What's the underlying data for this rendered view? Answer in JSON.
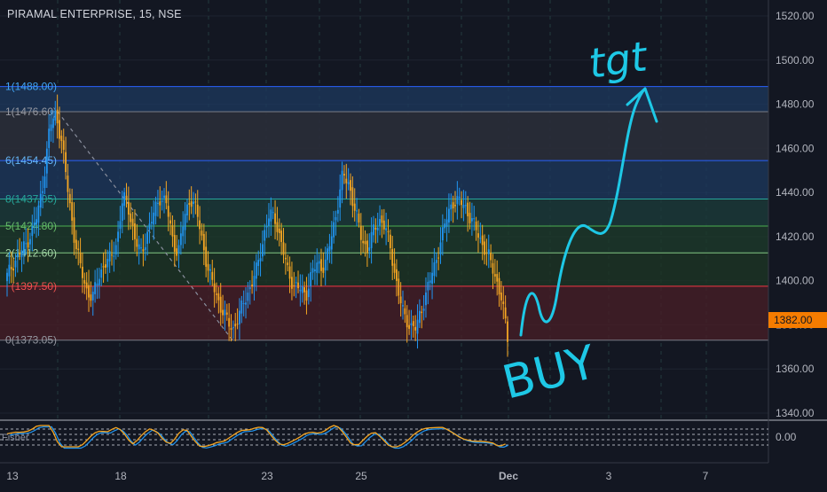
{
  "header": {
    "title": "PIRAMAL ENTERPRISE, 15, NSE"
  },
  "colors": {
    "background": "#131722",
    "grid": "#1e2330",
    "vgrid": "#233b3d",
    "candle_up": "#2196f3",
    "candle_down": "#f5a623",
    "axis_text": "#b2b5be",
    "annotation": "#1ec8e6",
    "price_badge": "#f57c00"
  },
  "price_axis": {
    "ticks": [
      "1520.00",
      "1500.00",
      "1480.00",
      "1460.00",
      "1440.00",
      "1420.00",
      "1400.00",
      "1380.00",
      "1360.00",
      "1340.00"
    ],
    "current_price": "1382.00"
  },
  "time_axis": {
    "ticks": [
      "13",
      "18",
      "23",
      "25",
      "Dec",
      "3",
      "7"
    ]
  },
  "oscillator": {
    "label": "Fisher",
    "tick": "0.00"
  },
  "annotations": {
    "target": "tgt",
    "action": "BUY"
  },
  "chart_data": {
    "type": "candlestick",
    "title": "PIRAMAL ENTERPRISE, 15, NSE",
    "ylim": [
      1332,
      1528
    ],
    "y_ticks": [
      1520,
      1500,
      1480,
      1460,
      1440,
      1420,
      1400,
      1380,
      1360,
      1340
    ],
    "x_ticks": [
      "13",
      "18",
      "23",
      "25",
      "Dec",
      "3",
      "7"
    ],
    "current_price": 1382,
    "fib_levels": [
      {
        "label": "1(1488.00)",
        "value": 1488.0,
        "color": "#2962ff",
        "label_color": "#42a5f5"
      },
      {
        "label": "1(1476.60)",
        "value": 1476.6,
        "color": "#787b86",
        "label_color": "#9598a1"
      },
      {
        "label": "6(1454.45)",
        "value": 1454.45,
        "color": "#2962ff",
        "label_color": "#64b5f6"
      },
      {
        "label": "8(1437.05)",
        "value": 1437.05,
        "color": "#26a69a",
        "label_color": "#26a69a"
      },
      {
        "label": "5(1424.80)",
        "value": 1424.8,
        "color": "#4caf50",
        "label_color": "#66bb6a"
      },
      {
        "label": "2(1412.60)",
        "value": 1412.6,
        "color": "#81c784",
        "label_color": "#a5d6a7"
      },
      {
        "label": "(1397.50)",
        "value": 1397.5,
        "color": "#f23645",
        "label_color": "#ef5350"
      },
      {
        "label": "0(1373.05)",
        "value": 1373.05,
        "color": "#787b86",
        "label_color": "#9598a1"
      }
    ],
    "price_path": [
      [
        0,
        1402
      ],
      [
        1,
        1408
      ],
      [
        2,
        1412
      ],
      [
        3,
        1416
      ],
      [
        4,
        1422
      ],
      [
        5,
        1430
      ],
      [
        6,
        1446
      ],
      [
        7,
        1470
      ],
      [
        8,
        1476
      ],
      [
        9,
        1462
      ],
      [
        10,
        1440
      ],
      [
        11,
        1420
      ],
      [
        12,
        1406
      ],
      [
        13,
        1396
      ],
      [
        14,
        1392
      ],
      [
        15,
        1402
      ],
      [
        16,
        1408
      ],
      [
        17,
        1410
      ],
      [
        18,
        1418
      ],
      [
        19,
        1438
      ],
      [
        20,
        1432
      ],
      [
        21,
        1418
      ],
      [
        22,
        1412
      ],
      [
        23,
        1422
      ],
      [
        24,
        1430
      ],
      [
        25,
        1438
      ],
      [
        26,
        1436
      ],
      [
        27,
        1420
      ],
      [
        28,
        1412
      ],
      [
        29,
        1428
      ],
      [
        30,
        1438
      ],
      [
        31,
        1432
      ],
      [
        32,
        1418
      ],
      [
        33,
        1404
      ],
      [
        34,
        1396
      ],
      [
        35,
        1388
      ],
      [
        36,
        1382
      ],
      [
        37,
        1378
      ],
      [
        38,
        1384
      ],
      [
        39,
        1392
      ],
      [
        40,
        1398
      ],
      [
        41,
        1406
      ],
      [
        42,
        1420
      ],
      [
        43,
        1430
      ],
      [
        44,
        1428
      ],
      [
        45,
        1416
      ],
      [
        46,
        1404
      ],
      [
        47,
        1398
      ],
      [
        48,
        1396
      ],
      [
        49,
        1394
      ],
      [
        50,
        1404
      ],
      [
        51,
        1408
      ],
      [
        52,
        1406
      ],
      [
        53,
        1418
      ],
      [
        54,
        1432
      ],
      [
        55,
        1448
      ],
      [
        56,
        1444
      ],
      [
        57,
        1432
      ],
      [
        58,
        1420
      ],
      [
        59,
        1414
      ],
      [
        60,
        1422
      ],
      [
        61,
        1428
      ],
      [
        62,
        1424
      ],
      [
        63,
        1412
      ],
      [
        64,
        1396
      ],
      [
        65,
        1384
      ],
      [
        66,
        1380
      ],
      [
        67,
        1378
      ],
      [
        68,
        1388
      ],
      [
        69,
        1398
      ],
      [
        70,
        1406
      ],
      [
        71,
        1418
      ],
      [
        72,
        1428
      ],
      [
        73,
        1436
      ],
      [
        74,
        1436
      ],
      [
        75,
        1434
      ],
      [
        76,
        1428
      ],
      [
        77,
        1422
      ],
      [
        78,
        1416
      ],
      [
        79,
        1410
      ],
      [
        80,
        1402
      ],
      [
        81,
        1392
      ],
      [
        82,
        1374
      ]
    ],
    "oscillator": {
      "label": "Fisher",
      "value": 0.0
    },
    "legend": "none"
  }
}
